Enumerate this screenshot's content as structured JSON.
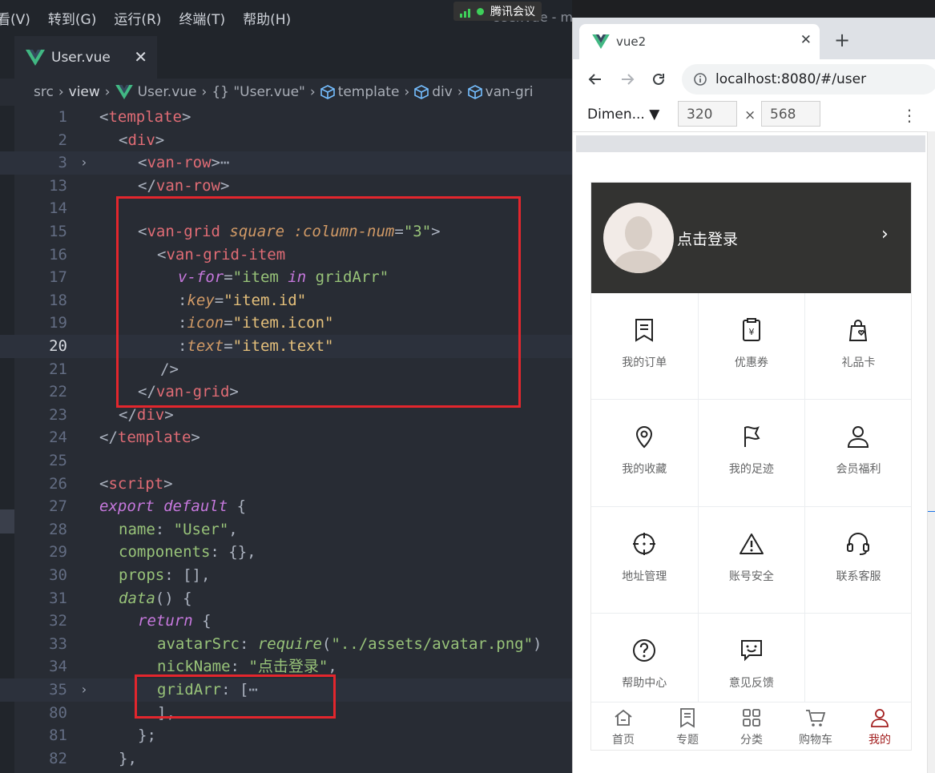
{
  "colors": {
    "editor_bg": "#282c34",
    "tag": "#e06c75",
    "string": "#98c379",
    "attr": "#d19a66",
    "keyword": "#c678dd",
    "highlight_box": "#e3262d",
    "user_header_bg": "#333331",
    "active_tab": "#a32020"
  },
  "menubar": {
    "items": [
      "看(V)",
      "转到(G)",
      "运行(R)",
      "终端(T)",
      "帮助(H)"
    ]
  },
  "meeting_badge": {
    "label": "腾讯会议"
  },
  "window_title": "User.vue - myapp - Visual Studio Code",
  "editor_tab": {
    "label": "User.vue",
    "close": "✕"
  },
  "breadcrumb": [
    "src",
    "view",
    "User.vue",
    "{} \"User.vue\"",
    "template",
    "div",
    "van-gri"
  ],
  "code_lines": [
    {
      "n": "1"
    },
    {
      "n": "2"
    },
    {
      "n": "3"
    },
    {
      "n": "13"
    },
    {
      "n": "14"
    },
    {
      "n": "15"
    },
    {
      "n": "16"
    },
    {
      "n": "17"
    },
    {
      "n": "18"
    },
    {
      "n": "19"
    },
    {
      "n": "20"
    },
    {
      "n": "21"
    },
    {
      "n": "22"
    },
    {
      "n": "23"
    },
    {
      "n": "24"
    },
    {
      "n": "25"
    },
    {
      "n": "26"
    },
    {
      "n": "27"
    },
    {
      "n": "28"
    },
    {
      "n": "29"
    },
    {
      "n": "30"
    },
    {
      "n": "31"
    },
    {
      "n": "32"
    },
    {
      "n": "33"
    },
    {
      "n": "34"
    },
    {
      "n": "35"
    },
    {
      "n": "80"
    },
    {
      "n": "81"
    },
    {
      "n": "82"
    }
  ],
  "code_text": {
    "l1": [
      "<",
      "template",
      ">"
    ],
    "l2": [
      "<",
      "div",
      ">"
    ],
    "l3": [
      "<",
      "van-row",
      ">",
      "⋯"
    ],
    "l13": [
      "</",
      "van-row",
      ">"
    ],
    "l15": [
      "<",
      "van-grid",
      " ",
      "square",
      " ",
      ":column-num",
      "=",
      "\"3\"",
      ">"
    ],
    "l16": [
      "<",
      "van-grid-item"
    ],
    "l17": [
      "v-for",
      "=",
      "\"item ",
      "in",
      " gridArr\""
    ],
    "l18": [
      ":",
      "key",
      "=",
      "\"item.id\""
    ],
    "l19": [
      ":",
      "icon",
      "=",
      "\"item.icon\""
    ],
    "l20": [
      ":",
      "text",
      "=",
      "\"item.text\""
    ],
    "l21": [
      "/>"
    ],
    "l22": [
      "</",
      "van-grid",
      ">"
    ],
    "l23": [
      "</",
      "div",
      ">"
    ],
    "l24": [
      "</",
      "template",
      ">"
    ],
    "l26": [
      "<",
      "script",
      ">"
    ],
    "l27": [
      "export default",
      " {"
    ],
    "l28": [
      "name",
      ": ",
      "\"User\"",
      ","
    ],
    "l29": [
      "components",
      ": {},"
    ],
    "l30": [
      "props",
      ": [],"
    ],
    "l31": [
      "data",
      "() {"
    ],
    "l32": [
      "return",
      " {"
    ],
    "l33": [
      "avatarSrc",
      ": ",
      "require",
      "(",
      "\"../assets/avatar.png\"",
      ")"
    ],
    "l34": [
      "nickName",
      ": ",
      "\"点击登录\"",
      ","
    ],
    "l35": [
      "gridArr",
      ": [",
      "⋯"
    ],
    "l80": [
      "],"
    ],
    "l81": [
      "};"
    ],
    "l82": [
      "},"
    ]
  },
  "browser": {
    "tab_title": "vue2",
    "tab_close": "✕",
    "new_tab": "+",
    "url": "localhost:8080/#/user",
    "device": "Dimen... ▼",
    "width": "320",
    "times": "×",
    "height": "568",
    "kebab": "⋮"
  },
  "user_page": {
    "nickname": "点击登录",
    "chevron": "›",
    "grid": [
      {
        "text": "我的订单",
        "icon": "bookmark-icon"
      },
      {
        "text": "优惠券",
        "icon": "coupon-icon"
      },
      {
        "text": "礼品卡",
        "icon": "gift-card-icon"
      },
      {
        "text": "我的收藏",
        "icon": "location-icon"
      },
      {
        "text": "我的足迹",
        "icon": "flag-icon"
      },
      {
        "text": "会员福利",
        "icon": "user-icon"
      },
      {
        "text": "地址管理",
        "icon": "aim-icon"
      },
      {
        "text": "账号安全",
        "icon": "warning-icon"
      },
      {
        "text": "联系客服",
        "icon": "headset-icon"
      },
      {
        "text": "帮助中心",
        "icon": "help-icon"
      },
      {
        "text": "意见反馈",
        "icon": "feedback-icon"
      }
    ],
    "tabbar": [
      {
        "label": "首页",
        "icon": "home-icon"
      },
      {
        "label": "专题",
        "icon": "topic-icon"
      },
      {
        "label": "分类",
        "icon": "category-icon"
      },
      {
        "label": "购物车",
        "icon": "cart-icon"
      },
      {
        "label": "我的",
        "icon": "user-icon",
        "active": true
      }
    ]
  }
}
